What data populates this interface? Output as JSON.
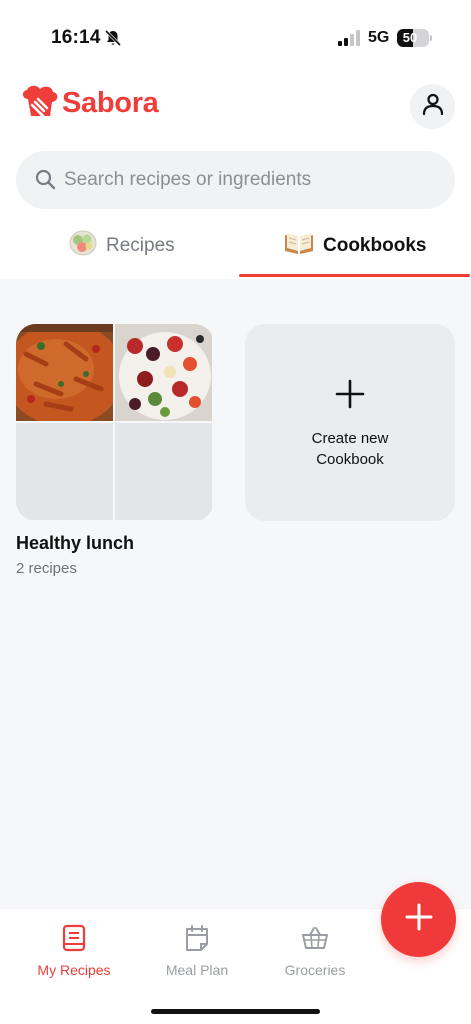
{
  "status_bar": {
    "time": "16:14",
    "network": "5G",
    "battery": "50",
    "battery_level": 0.5
  },
  "header": {
    "brand": "Sabora",
    "logo_icon": "chef-hat-whisk-icon",
    "profile_icon": "user-icon"
  },
  "search": {
    "placeholder": "Search recipes or ingredients",
    "value": ""
  },
  "tabs": [
    {
      "label": "Recipes",
      "icon": "salad-bowl-icon",
      "active": false
    },
    {
      "label": "Cookbooks",
      "icon": "open-book-icon",
      "active": true
    }
  ],
  "cookbooks": [
    {
      "title": "Healthy lunch",
      "count": "2 recipes"
    }
  ],
  "create_card": {
    "label": "Create new Cookbook"
  },
  "bottom_nav": [
    {
      "label": "My Recipes",
      "icon": "book-icon",
      "active": true
    },
    {
      "label": "Meal Plan",
      "icon": "calendar-icon",
      "active": false
    },
    {
      "label": "Groceries",
      "icon": "basket-icon",
      "active": false
    }
  ],
  "colors": {
    "accent": "#ef3d3a",
    "background": "#f6f7f9",
    "muted": "#9a9ea4"
  }
}
